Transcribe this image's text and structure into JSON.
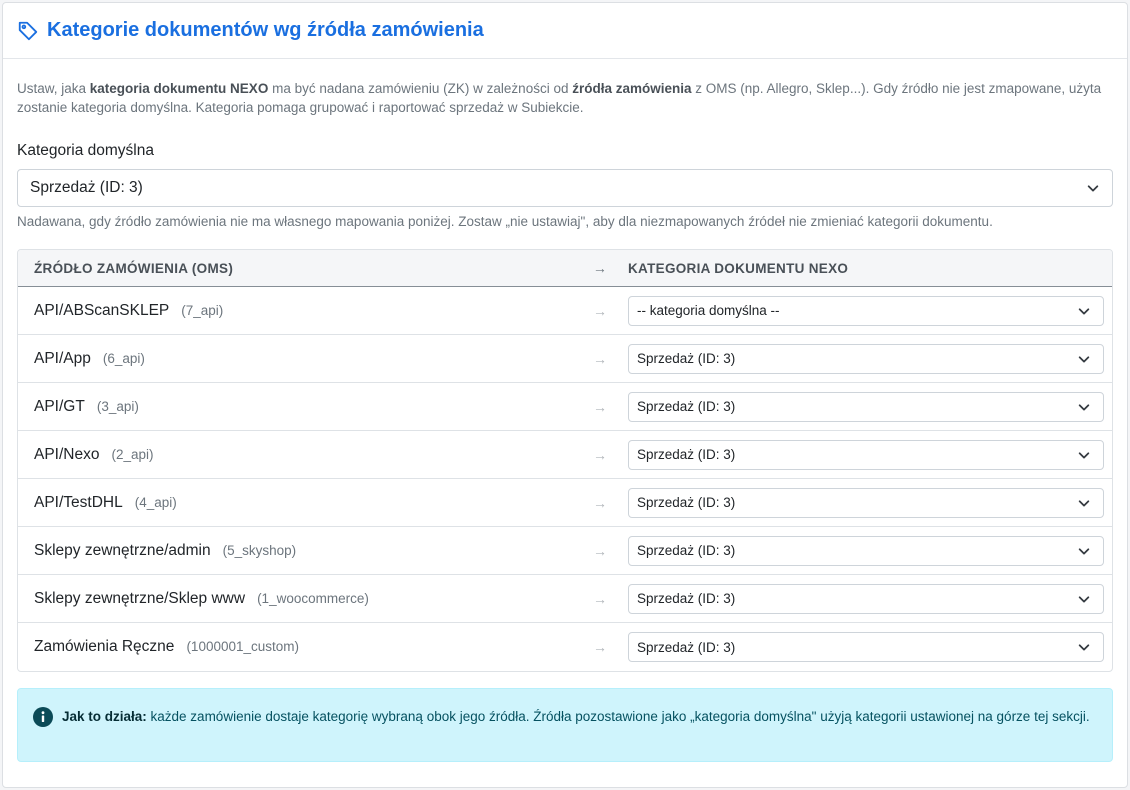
{
  "header": {
    "title": "Kategorie dokumentów wg źródła zamówienia",
    "icon": "tag-icon",
    "accent_color": "#1a6fe0"
  },
  "intro": {
    "p1": "Ustaw, jaka ",
    "b1": "kategoria dokumentu NEXO",
    "p2": " ma być nadana zamówieniu (ZK) w zależności od ",
    "b2": "źródła zamówienia",
    "p3": " z OMS (np. Allegro, Sklep...). Gdy źródło nie jest zmapowane, użyta zostanie kategoria domyślna. Kategoria pomaga grupować i raportować sprzedaż w Subiekcie."
  },
  "default_category": {
    "label": "Kategoria domyślna",
    "value": "Sprzedaż (ID: 3)",
    "help": "Nadawana, gdy źródło zamówienia nie ma własnego mapowania poniżej. Zostaw „nie ustawiaj\", aby dla niezmapowanych źródeł nie zmieniać kategorii dokumentu."
  },
  "mapping": {
    "headers": {
      "source": "ŹRÓDŁO ZAMÓWIENIA (OMS)",
      "arrow": "→",
      "category": "KATEGORIA DOKUMENTU NEXO"
    },
    "arrow": "→",
    "rows": [
      {
        "name": "API/ABScanSKLEP",
        "code": "(7_api)",
        "category": "-- kategoria domyślna --"
      },
      {
        "name": "API/App",
        "code": "(6_api)",
        "category": "Sprzedaż (ID: 3)"
      },
      {
        "name": "API/GT",
        "code": "(3_api)",
        "category": "Sprzedaż (ID: 3)"
      },
      {
        "name": "API/Nexo",
        "code": "(2_api)",
        "category": "Sprzedaż (ID: 3)"
      },
      {
        "name": "API/TestDHL",
        "code": "(4_api)",
        "category": "Sprzedaż (ID: 3)"
      },
      {
        "name": "Sklepy zewnętrzne/admin",
        "code": "(5_skyshop)",
        "category": "Sprzedaż (ID: 3)"
      },
      {
        "name": "Sklepy zewnętrzne/Sklep www",
        "code": "(1_woocommerce)",
        "category": "Sprzedaż (ID: 3)"
      },
      {
        "name": "Zamówienia Ręczne",
        "code": "(1000001_custom)",
        "category": "Sprzedaż (ID: 3)"
      }
    ]
  },
  "info": {
    "icon": "info-icon",
    "bold": "Jak to działa:",
    "text": " każde zamówienie dostaje kategorię wybraną obok jego źródła. Źródła pozostawione jako „kategoria domyślna\" użyją kategorii ustawionej na górze tej sekcji.",
    "background": "#cff4fc"
  }
}
